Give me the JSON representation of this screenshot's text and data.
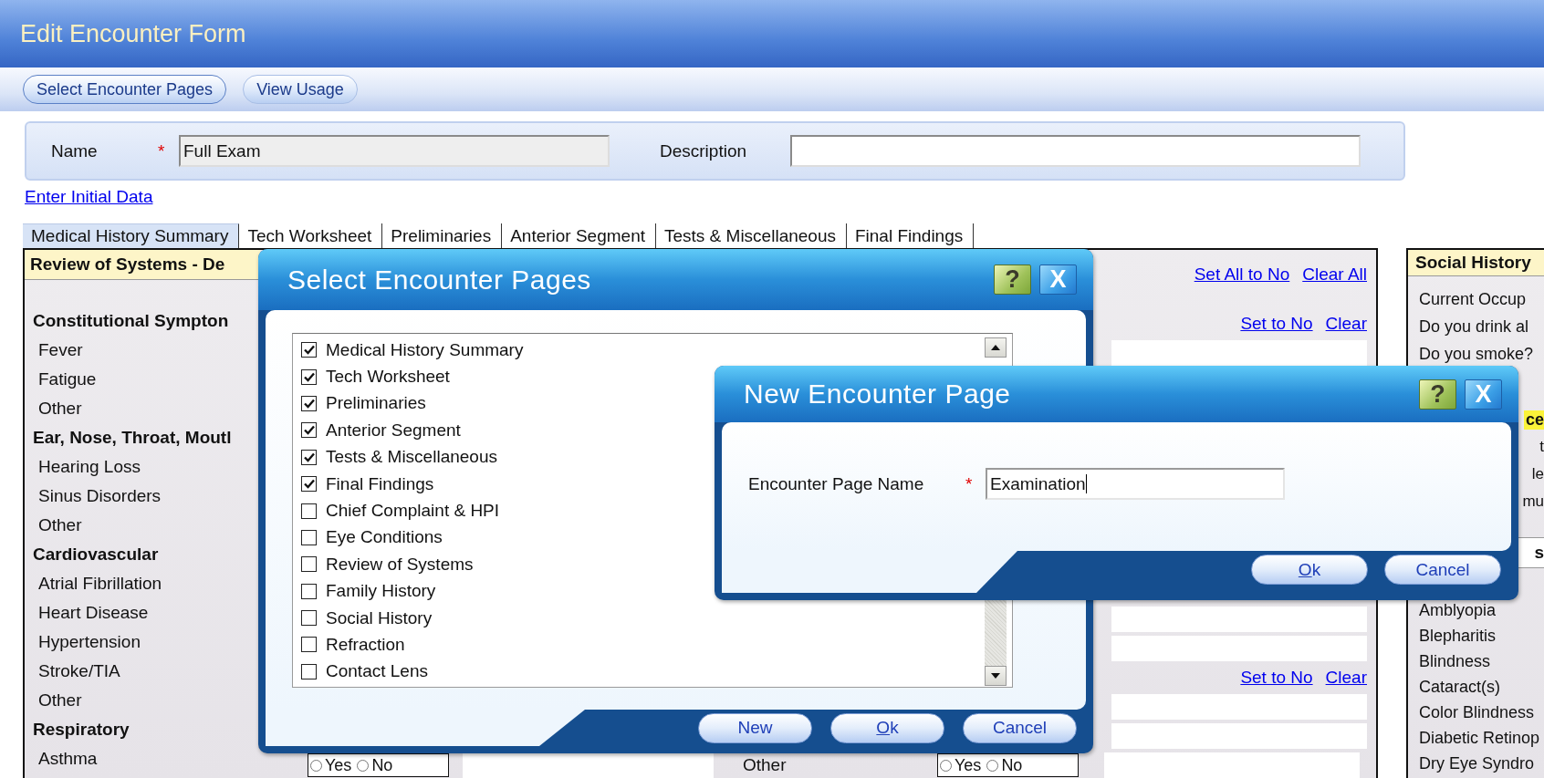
{
  "window": {
    "title": "Edit Encounter Form"
  },
  "toolbar": [
    {
      "label": "Select Encounter Pages",
      "selected": true
    },
    {
      "label": "View Usage",
      "selected": false
    }
  ],
  "form": {
    "name_label": "Name",
    "required_mark": "*",
    "name_value": "Full Exam",
    "description_label": "Description"
  },
  "link": "Enter Initial Data",
  "tabs": [
    {
      "label": "Medical History Summary",
      "selected": true
    },
    {
      "label": "Tech Worksheet",
      "selected": false
    },
    {
      "label": "Preliminaries",
      "selected": false
    },
    {
      "label": "Anterior Segment",
      "selected": false
    },
    {
      "label": "Tests & Miscellaneous",
      "selected": false
    },
    {
      "label": "Final Findings",
      "selected": false
    }
  ],
  "review_panel": {
    "title": "Review of Systems - De",
    "groups": [
      {
        "heading": "Constitutional Sympton",
        "items": [
          "Fever",
          "Fatigue",
          "Other"
        ]
      },
      {
        "heading": "Ear, Nose, Throat, Moutl",
        "items": [
          "Hearing Loss",
          "Sinus Disorders",
          "Other"
        ]
      },
      {
        "heading": "Cardiovascular",
        "items": [
          "Atrial Fibrillation",
          "Heart Disease",
          "Hypertension",
          "Stroke/TIA",
          "Other"
        ]
      },
      {
        "heading": "Respiratory",
        "items": [
          "Asthma"
        ]
      }
    ],
    "top_rows": [
      {
        "kind": "links",
        "links": [
          "Set All to No",
          "Clear All"
        ]
      },
      {
        "kind": "links",
        "links": [
          "Set to No",
          "Clear"
        ]
      },
      {
        "kind": "field"
      }
    ],
    "bottom_rows": [
      {
        "kind": "field"
      },
      {
        "kind": "field"
      },
      {
        "kind": "links",
        "links": [
          "Set to No",
          "Clear"
        ]
      },
      {
        "kind": "field"
      },
      {
        "kind": "field"
      }
    ],
    "answer_row": [
      {
        "kind": "radios",
        "options": [
          {
            "label": "Yes",
            "selected": false
          },
          {
            "label": "No",
            "selected": false
          }
        ]
      },
      {
        "kind": "field"
      },
      {
        "kind": "label",
        "text": "Other"
      },
      {
        "kind": "radios",
        "options": [
          {
            "label": "Yes",
            "selected": false
          },
          {
            "label": "No",
            "selected": false
          }
        ]
      },
      {
        "kind": "field"
      }
    ]
  },
  "side_panel": [
    {
      "title": "Social History",
      "kind": "full",
      "items": [
        {
          "kind": "text",
          "text": "Current Occup"
        },
        {
          "kind": "text",
          "text": "Do you drink al"
        },
        {
          "kind": "text",
          "text": "Do you smoke?"
        },
        {
          "kind": "highlight",
          "text": "ce"
        },
        {
          "kind": "fragment",
          "text": "t"
        },
        {
          "kind": "fragment",
          "text": "le"
        },
        {
          "kind": "fragment",
          "text": "mu"
        }
      ]
    },
    {
      "title": "s",
      "kind": "fragment",
      "items": [
        {
          "kind": "text",
          "text": "Amblyopia"
        },
        {
          "kind": "text",
          "text": "Blepharitis"
        },
        {
          "kind": "text",
          "text": "Blindness"
        },
        {
          "kind": "text",
          "text": "Cataract(s)"
        },
        {
          "kind": "text",
          "text": "Color Blindness"
        },
        {
          "kind": "text",
          "text": "Diabetic Retinop"
        },
        {
          "kind": "text",
          "text": "Dry Eye Syndro"
        }
      ]
    }
  ],
  "select_dialog": {
    "title": "Select Encounter Pages",
    "help": "?",
    "close": "X",
    "pages": [
      {
        "label": "Medical History Summary",
        "checked": true
      },
      {
        "label": "Tech Worksheet",
        "checked": true
      },
      {
        "label": "Preliminaries",
        "checked": true
      },
      {
        "label": "Anterior Segment",
        "checked": true
      },
      {
        "label": "Tests & Miscellaneous",
        "checked": true
      },
      {
        "label": "Final Findings",
        "checked": true
      },
      {
        "label": "Chief Complaint & HPI",
        "checked": false
      },
      {
        "label": "Eye Conditions",
        "checked": false
      },
      {
        "label": "Review of Systems",
        "checked": false
      },
      {
        "label": "Family History",
        "checked": false
      },
      {
        "label": "Social History",
        "checked": false
      },
      {
        "label": "Refraction",
        "checked": false
      },
      {
        "label": "Contact Lens",
        "checked": false
      }
    ],
    "buttons": [
      "New",
      "Ok",
      "Cancel"
    ]
  },
  "new_dialog": {
    "title": "New Encounter Page",
    "help": "?",
    "close": "X",
    "field_label": "Encounter Page Name",
    "required_mark": "*",
    "field_value": "Examination",
    "buttons": [
      "Ok",
      "Cancel"
    ]
  }
}
